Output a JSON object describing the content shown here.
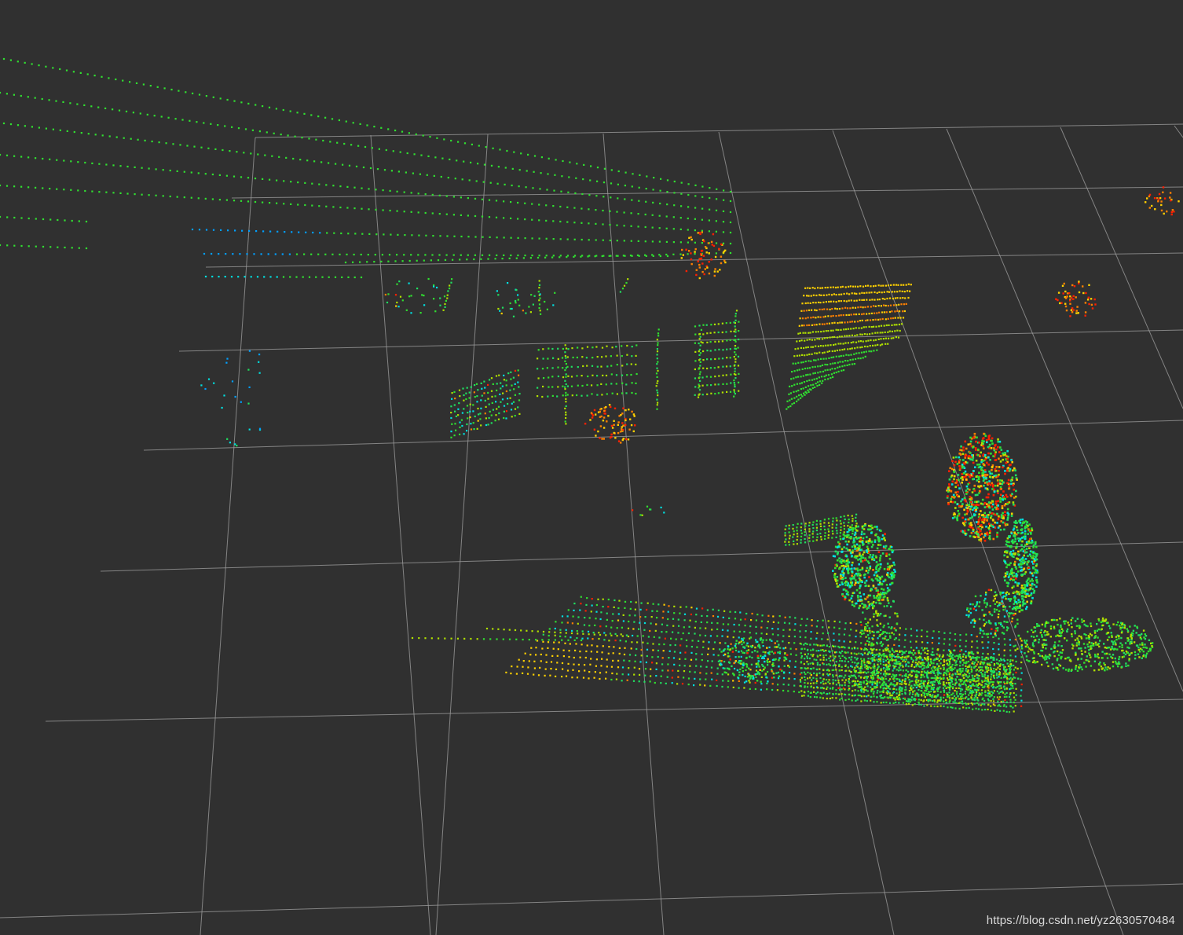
{
  "view": {
    "type": "3D point cloud viewport",
    "background_color": "#303030",
    "grid_color": "#a0a0a0"
  },
  "colormap": {
    "description": "intensity colormap, low to high",
    "stops": [
      "#1e3cff",
      "#00a0ff",
      "#00e0e0",
      "#20e060",
      "#30e030",
      "#b0e000",
      "#ffd000",
      "#ff8000",
      "#ff2000"
    ]
  },
  "watermark": {
    "text": "https://blog.csdn.net/yz2630570484"
  }
}
